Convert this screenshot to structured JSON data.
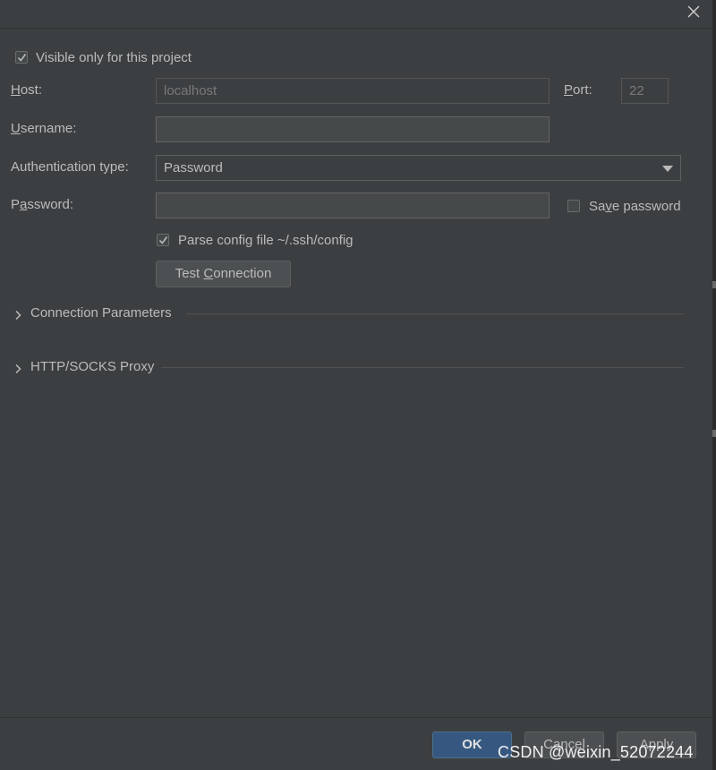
{
  "window": {
    "close_icon": "close-icon"
  },
  "visible_only": {
    "label": "Visible only for this project",
    "checked": true
  },
  "host": {
    "label_mnemonic": "H",
    "label_rest": "ost:",
    "value": "localhost"
  },
  "port": {
    "label_mnemonic": "P",
    "label_rest": "ort:",
    "value": "22"
  },
  "username": {
    "label_mnemonic": "U",
    "label_rest": "sername:",
    "value": ""
  },
  "auth_type": {
    "label": "Authentication type:",
    "value": "Password"
  },
  "password": {
    "label_pre": "P",
    "label_mnemonic": "a",
    "label_rest": "ssword:",
    "value": ""
  },
  "save_password": {
    "label_pre": "Sa",
    "label_mnemonic": "v",
    "label_rest": "e password",
    "checked": false
  },
  "parse_config": {
    "label": "Parse config file ~/.ssh/config",
    "checked": true
  },
  "test_connection": {
    "label_pre": "Test ",
    "label_mnemonic": "C",
    "label_rest": "onnection"
  },
  "sections": [
    {
      "title": "Connection Parameters",
      "expanded": false
    },
    {
      "title": "HTTP/SOCKS Proxy",
      "expanded": false
    }
  ],
  "footer": {
    "ok_label": "OK",
    "cancel_label": "Cancel",
    "apply_label": "Apply"
  },
  "watermark": "CSDN @weixin_52072244",
  "colors": {
    "background": "#3c3f41",
    "primary_button": "#365880"
  }
}
